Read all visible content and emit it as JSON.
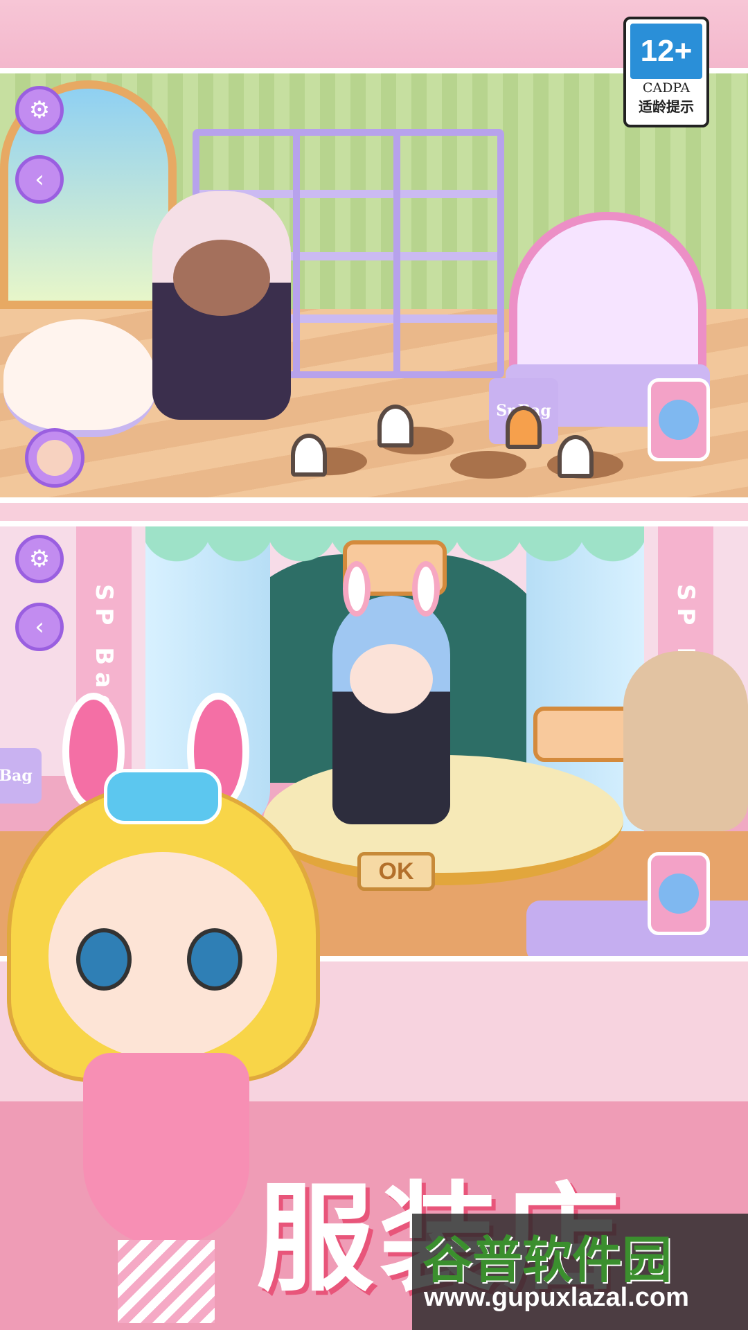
{
  "rating_badge": {
    "age": "12+",
    "org": "CADPA",
    "tip": "适龄提示"
  },
  "panel1": {
    "settings_icon": "gear-icon",
    "back_icon": "chevron-left-icon",
    "bag_label": "SpBag"
  },
  "panel2": {
    "settings_icon": "gear-icon",
    "back_icon": "chevron-left-icon",
    "pillar_text": "SP Bag",
    "bag_label": "pBag",
    "ok_label": "OK"
  },
  "title": "服装店",
  "watermark": {
    "name": "谷普软件园",
    "url": "www.gupuxlazal.com"
  },
  "colors": {
    "accent_purple": "#c28cf0",
    "pink_bg": "#ef9cb6",
    "title_shadow": "#e8557a"
  }
}
